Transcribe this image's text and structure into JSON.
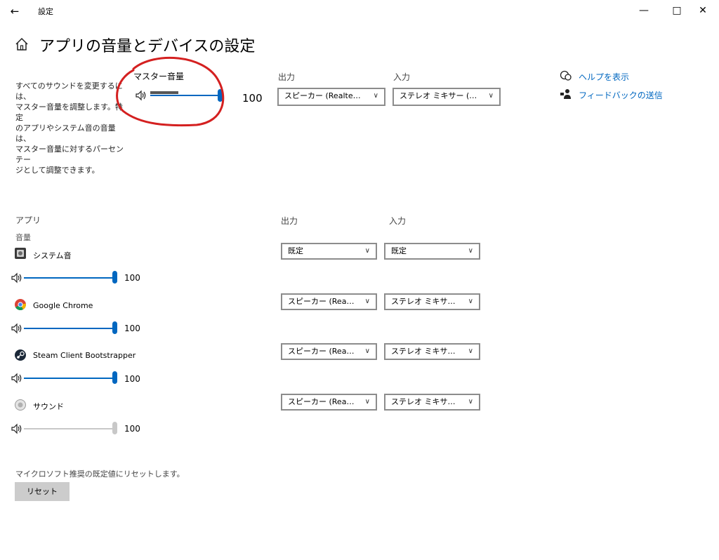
{
  "window": {
    "title": "設定",
    "back_icon": "←",
    "minimize": "—",
    "maximize": "□",
    "close": "✕"
  },
  "header": {
    "title": "アプリの音量とデバイスの設定",
    "home_icon": "home-icon"
  },
  "master": {
    "description_lines": [
      "すべてのサウンドを変更するには、",
      "マスター音量を調整します。特定",
      "のアプリやシステム音の音量は、",
      "マスター音量に対するパーセンテー",
      "ジとして調整できます。"
    ],
    "label": "マスター音量",
    "volume": 100,
    "volume_text": "100",
    "output_label": "出力",
    "output_value": "スピーカー (Realtek Hi...",
    "input_label": "入力",
    "input_value": "ステレオ ミキサー (Realt..."
  },
  "links": {
    "help": "ヘルプを表示",
    "feedback": "フィードバックの送信"
  },
  "apps": {
    "section_label": "アプリ",
    "volume_label": "音量",
    "output_col": "出力",
    "input_col": "入力",
    "items": [
      {
        "name": "システム音",
        "volume": 100,
        "volume_text": "100",
        "output": "既定",
        "input": "既定",
        "enabled": true
      },
      {
        "name": "Google Chrome",
        "volume": 100,
        "volume_text": "100",
        "output": "スピーカー (Realtek H",
        "input": "ステレオ ミキサー (Rea",
        "enabled": true
      },
      {
        "name": "Steam Client Bootstrapper",
        "volume": 100,
        "volume_text": "100",
        "output": "スピーカー (Realtek H",
        "input": "ステレオ ミキサー (Rea",
        "enabled": true
      },
      {
        "name": "サウンド",
        "volume": 100,
        "volume_text": "100",
        "output": "スピーカー (Realtek H",
        "input": "ステレオ ミキサー (Rea",
        "enabled": false
      }
    ]
  },
  "reset": {
    "hint": "マイクロソフト推奨の既定値にリセットします。",
    "button": "リセット"
  },
  "colors": {
    "accent": "#0067c0",
    "disabled": "#c8c8c8",
    "annotation": "#d42020"
  }
}
